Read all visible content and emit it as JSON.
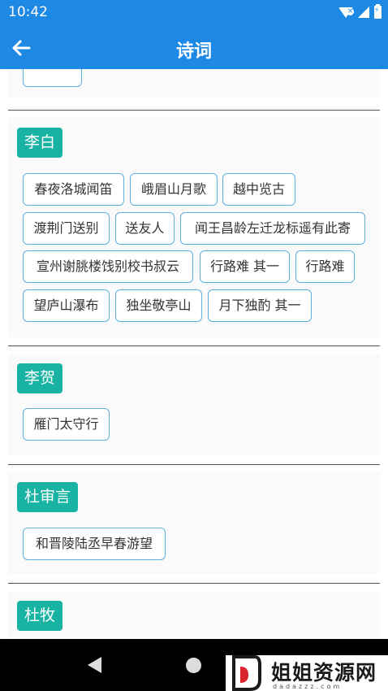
{
  "status": {
    "time": "10:42"
  },
  "app_bar": {
    "title": "诗词"
  },
  "authors": [
    {
      "name": "李白",
      "poems": [
        "春夜洛城闻笛",
        "峨眉山月歌",
        "越中览古",
        "渡荆门送别",
        "送友人",
        "闻王昌龄左迁龙标遥有此寄",
        "宣州谢朓楼饯别校书叔云",
        "行路难 其一",
        "行路难",
        "望庐山瀑布",
        "独坐敬亭山",
        "月下独酌 其一"
      ]
    },
    {
      "name": "李贺",
      "poems": [
        "雁门太守行"
      ]
    },
    {
      "name": "杜审言",
      "poems": [
        "和晋陵陆丞早春游望"
      ]
    },
    {
      "name": "杜牧",
      "poems": []
    }
  ],
  "watermark": {
    "title": "姐姐资源网",
    "subtitle": "dadazzz.com"
  },
  "colors": {
    "primary": "#1e88e5",
    "tag": "#19b3a3",
    "chip_border": "#5ab0e0"
  }
}
